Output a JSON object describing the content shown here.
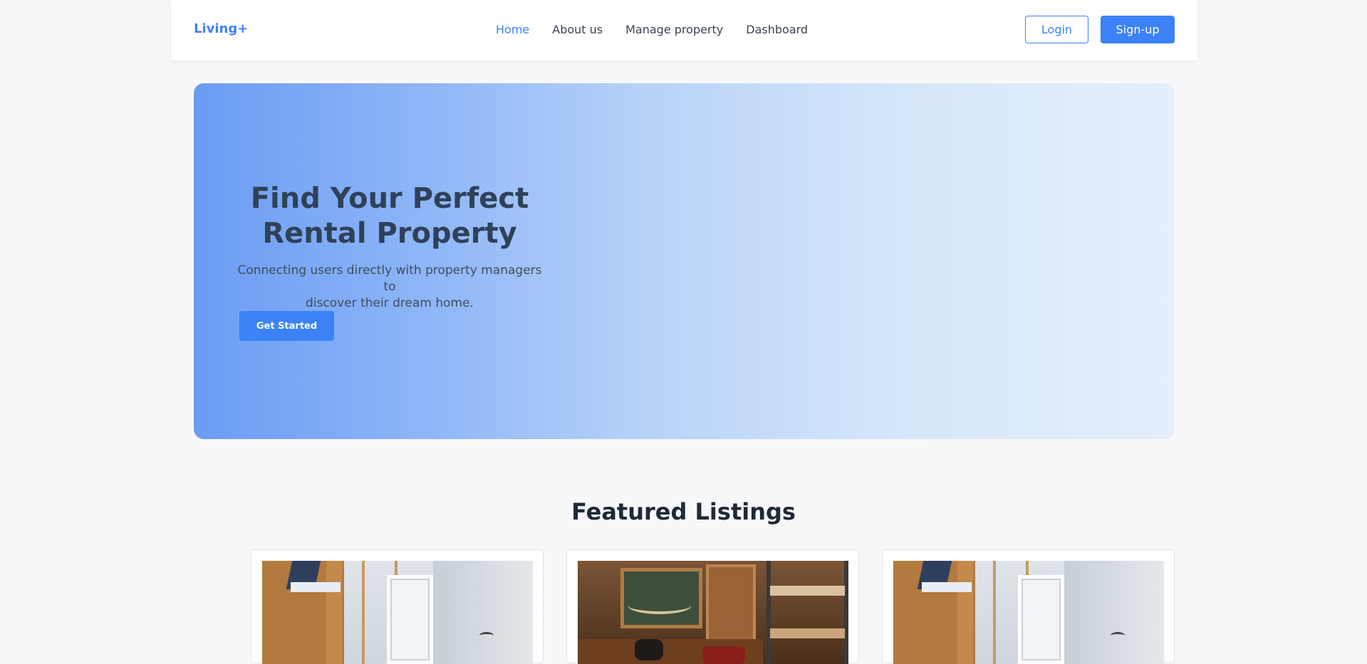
{
  "navbar": {
    "brand": "Living+",
    "links": [
      "Home",
      "About us",
      "Manage property",
      "Dashboard"
    ],
    "login_label": "Login",
    "signup_label": "Sign-up"
  },
  "hero": {
    "title_line1": "Find Your Perfect",
    "title_line2": "Rental Property",
    "subtitle_line1": "Connecting users directly with property managers to",
    "subtitle_line2": "discover their dream home.",
    "cta_label": "Get Started"
  },
  "featured": {
    "title": "Featured Listings"
  },
  "colors": {
    "accent": "#3b82f6",
    "background": "#f7f8fa"
  }
}
